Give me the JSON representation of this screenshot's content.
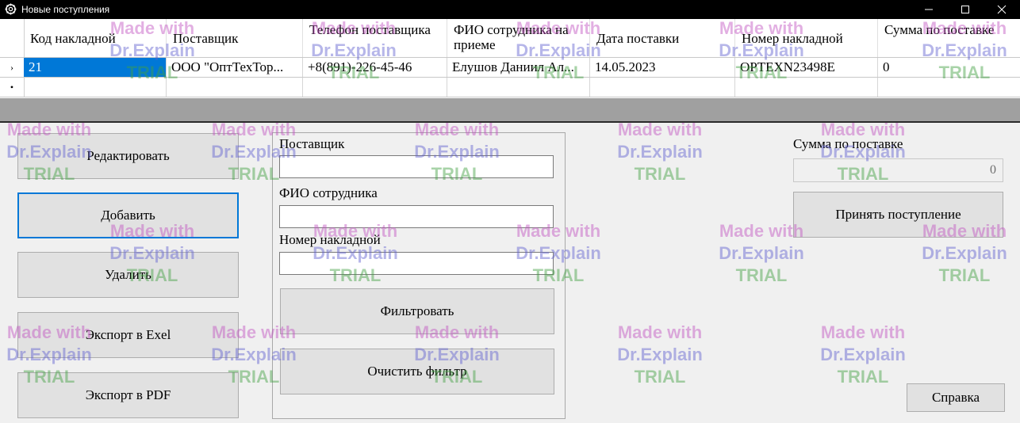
{
  "window": {
    "title": "Новые поступления",
    "icon": "gear-icon"
  },
  "grid": {
    "columns": [
      "Код накладной",
      "Поставщик",
      "Телефон поставщика",
      "ФИО сотрудника на приеме",
      "Дата поставки",
      "Номер накладной",
      "Сумма по поставке"
    ],
    "rows": [
      {
        "code": "21",
        "supplier": "ООО \"ОптТехТор...",
        "phone": "+8(891)-226-45-46",
        "employee": "Елушов Даниил Ал...",
        "date": "14.05.2023",
        "invoice": "OPTEXN23498E",
        "sum": "0"
      }
    ],
    "row_marker_current": "›",
    "row_marker_new": "•"
  },
  "buttons": {
    "edit": "Редактировать",
    "add": "Добавить",
    "delete": "Удалить",
    "export_excel": "Экспорт в Exel",
    "export_pdf": "Экспорт в PDF",
    "filter": "Фильтровать",
    "clear_filter": "Очистить фильтр",
    "accept": "Принять поступление",
    "help": "Справка"
  },
  "filter": {
    "supplier_label": "Поставщик",
    "supplier_value": "",
    "employee_label": "ФИО сотрудника",
    "employee_value": "",
    "invoice_label": "Номер накладной",
    "invoice_value": ""
  },
  "summary": {
    "sum_label": "Сумма по поставке",
    "sum_value": "0"
  },
  "watermark": {
    "line1": "Made with",
    "line2": "Dr.Explain",
    "line3": "TRIAL"
  }
}
